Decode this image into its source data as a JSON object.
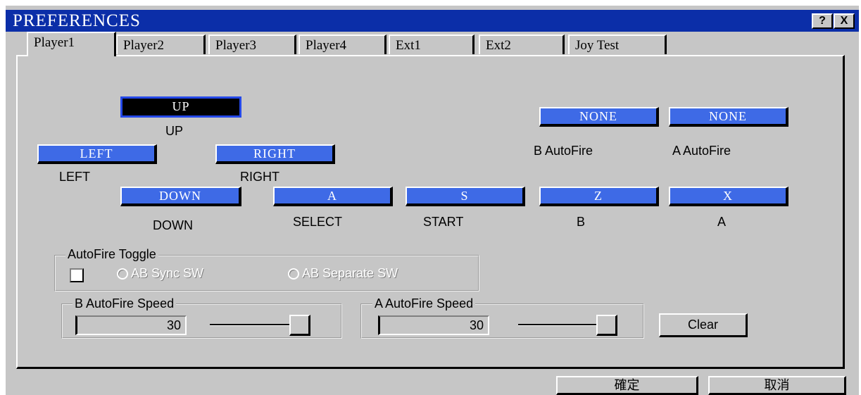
{
  "window": {
    "title": "PREFERENCES",
    "help_label": "?",
    "close_label": "X"
  },
  "tabs": [
    "Player1",
    "Player2",
    "Player3",
    "Player4",
    "Ext1",
    "Ext2",
    "Joy Test"
  ],
  "active_tab": "Player1",
  "keys": {
    "up": {
      "key": "UP",
      "label": "UP"
    },
    "left": {
      "key": "LEFT",
      "label": "LEFT"
    },
    "right": {
      "key": "RIGHT",
      "label": "RIGHT"
    },
    "down": {
      "key": "DOWN",
      "label": "DOWN"
    },
    "select": {
      "key": "A",
      "label": "SELECT"
    },
    "start": {
      "key": "S",
      "label": "START"
    },
    "b": {
      "key": "Z",
      "label": "B"
    },
    "a": {
      "key": "X",
      "label": "A"
    },
    "b_auto": {
      "key": "NONE",
      "label": "B AutoFire"
    },
    "a_auto": {
      "key": "NONE",
      "label": "A AutoFire"
    }
  },
  "autofire_toggle": {
    "title": "AutoFire Toggle",
    "checked": false,
    "option_sync": "AB Sync SW",
    "option_separate": "AB Separate SW"
  },
  "b_speed": {
    "title": "B AutoFire Speed",
    "value": "30",
    "slider_fraction": 0.95
  },
  "a_speed": {
    "title": "A AutoFire Speed",
    "value": "30",
    "slider_fraction": 0.95
  },
  "clear_label": "Clear",
  "ok_label": "確定",
  "cancel_label": "取消",
  "colors": {
    "title_bar": "#0b2ea8",
    "key_button": "#3e6ae6",
    "face": "#c6c6c6"
  }
}
